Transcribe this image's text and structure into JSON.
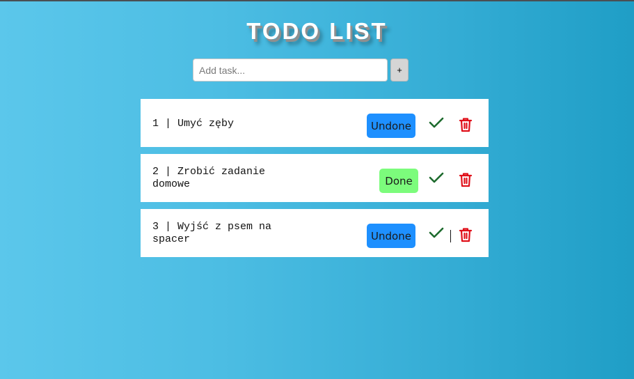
{
  "app": {
    "title": "TODO LIST"
  },
  "add_task": {
    "placeholder": "Add task...",
    "value": "",
    "button_label": "+"
  },
  "colors": {
    "undone": "#1e90ff",
    "done": "#7cfc7c",
    "check": "#1e6b2e",
    "trash": "#e0101a"
  },
  "tasks": [
    {
      "label": "1 | Umyć zęby",
      "status_label": "Undone",
      "check_icon": "check-icon",
      "delete_icon": "trash-icon"
    },
    {
      "label": "2 | Zrobić zadanie domowe",
      "status_label": "Done",
      "check_icon": "check-icon",
      "delete_icon": "trash-icon"
    },
    {
      "label": "3 | Wyjść z psem na spacer",
      "status_label": "Undone",
      "check_icon": "check-icon",
      "delete_icon": "trash-icon"
    }
  ]
}
